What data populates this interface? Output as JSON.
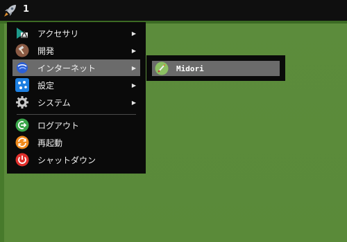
{
  "taskbar": {
    "launcher_icon": "rocket-icon",
    "workspace_number": "1"
  },
  "menu": {
    "items": [
      {
        "label": "アクセサリ",
        "icon": "accessories-icon",
        "has_submenu": true
      },
      {
        "label": "開発",
        "icon": "hammer-icon",
        "has_submenu": true
      },
      {
        "label": "インターネット",
        "icon": "globe-icon",
        "has_submenu": true,
        "highlighted": true
      },
      {
        "label": "設定",
        "icon": "settings-icon",
        "has_submenu": true
      },
      {
        "label": "システム",
        "icon": "gear-icon",
        "has_submenu": true
      },
      {
        "label": "ログアウト",
        "icon": "logout-icon",
        "has_submenu": false
      },
      {
        "label": "再起動",
        "icon": "restart-icon",
        "has_submenu": false
      },
      {
        "label": "シャットダウン",
        "icon": "power-icon",
        "has_submenu": false
      }
    ],
    "submenu_arrow": "▶"
  },
  "submenu": {
    "items": [
      {
        "label": "Midori",
        "icon": "midori-icon",
        "highlighted": true
      }
    ]
  },
  "colors": {
    "desktop_background": "#5a8a39",
    "menu_background": "#0a0a0a",
    "highlight": "#6b6b6b"
  }
}
